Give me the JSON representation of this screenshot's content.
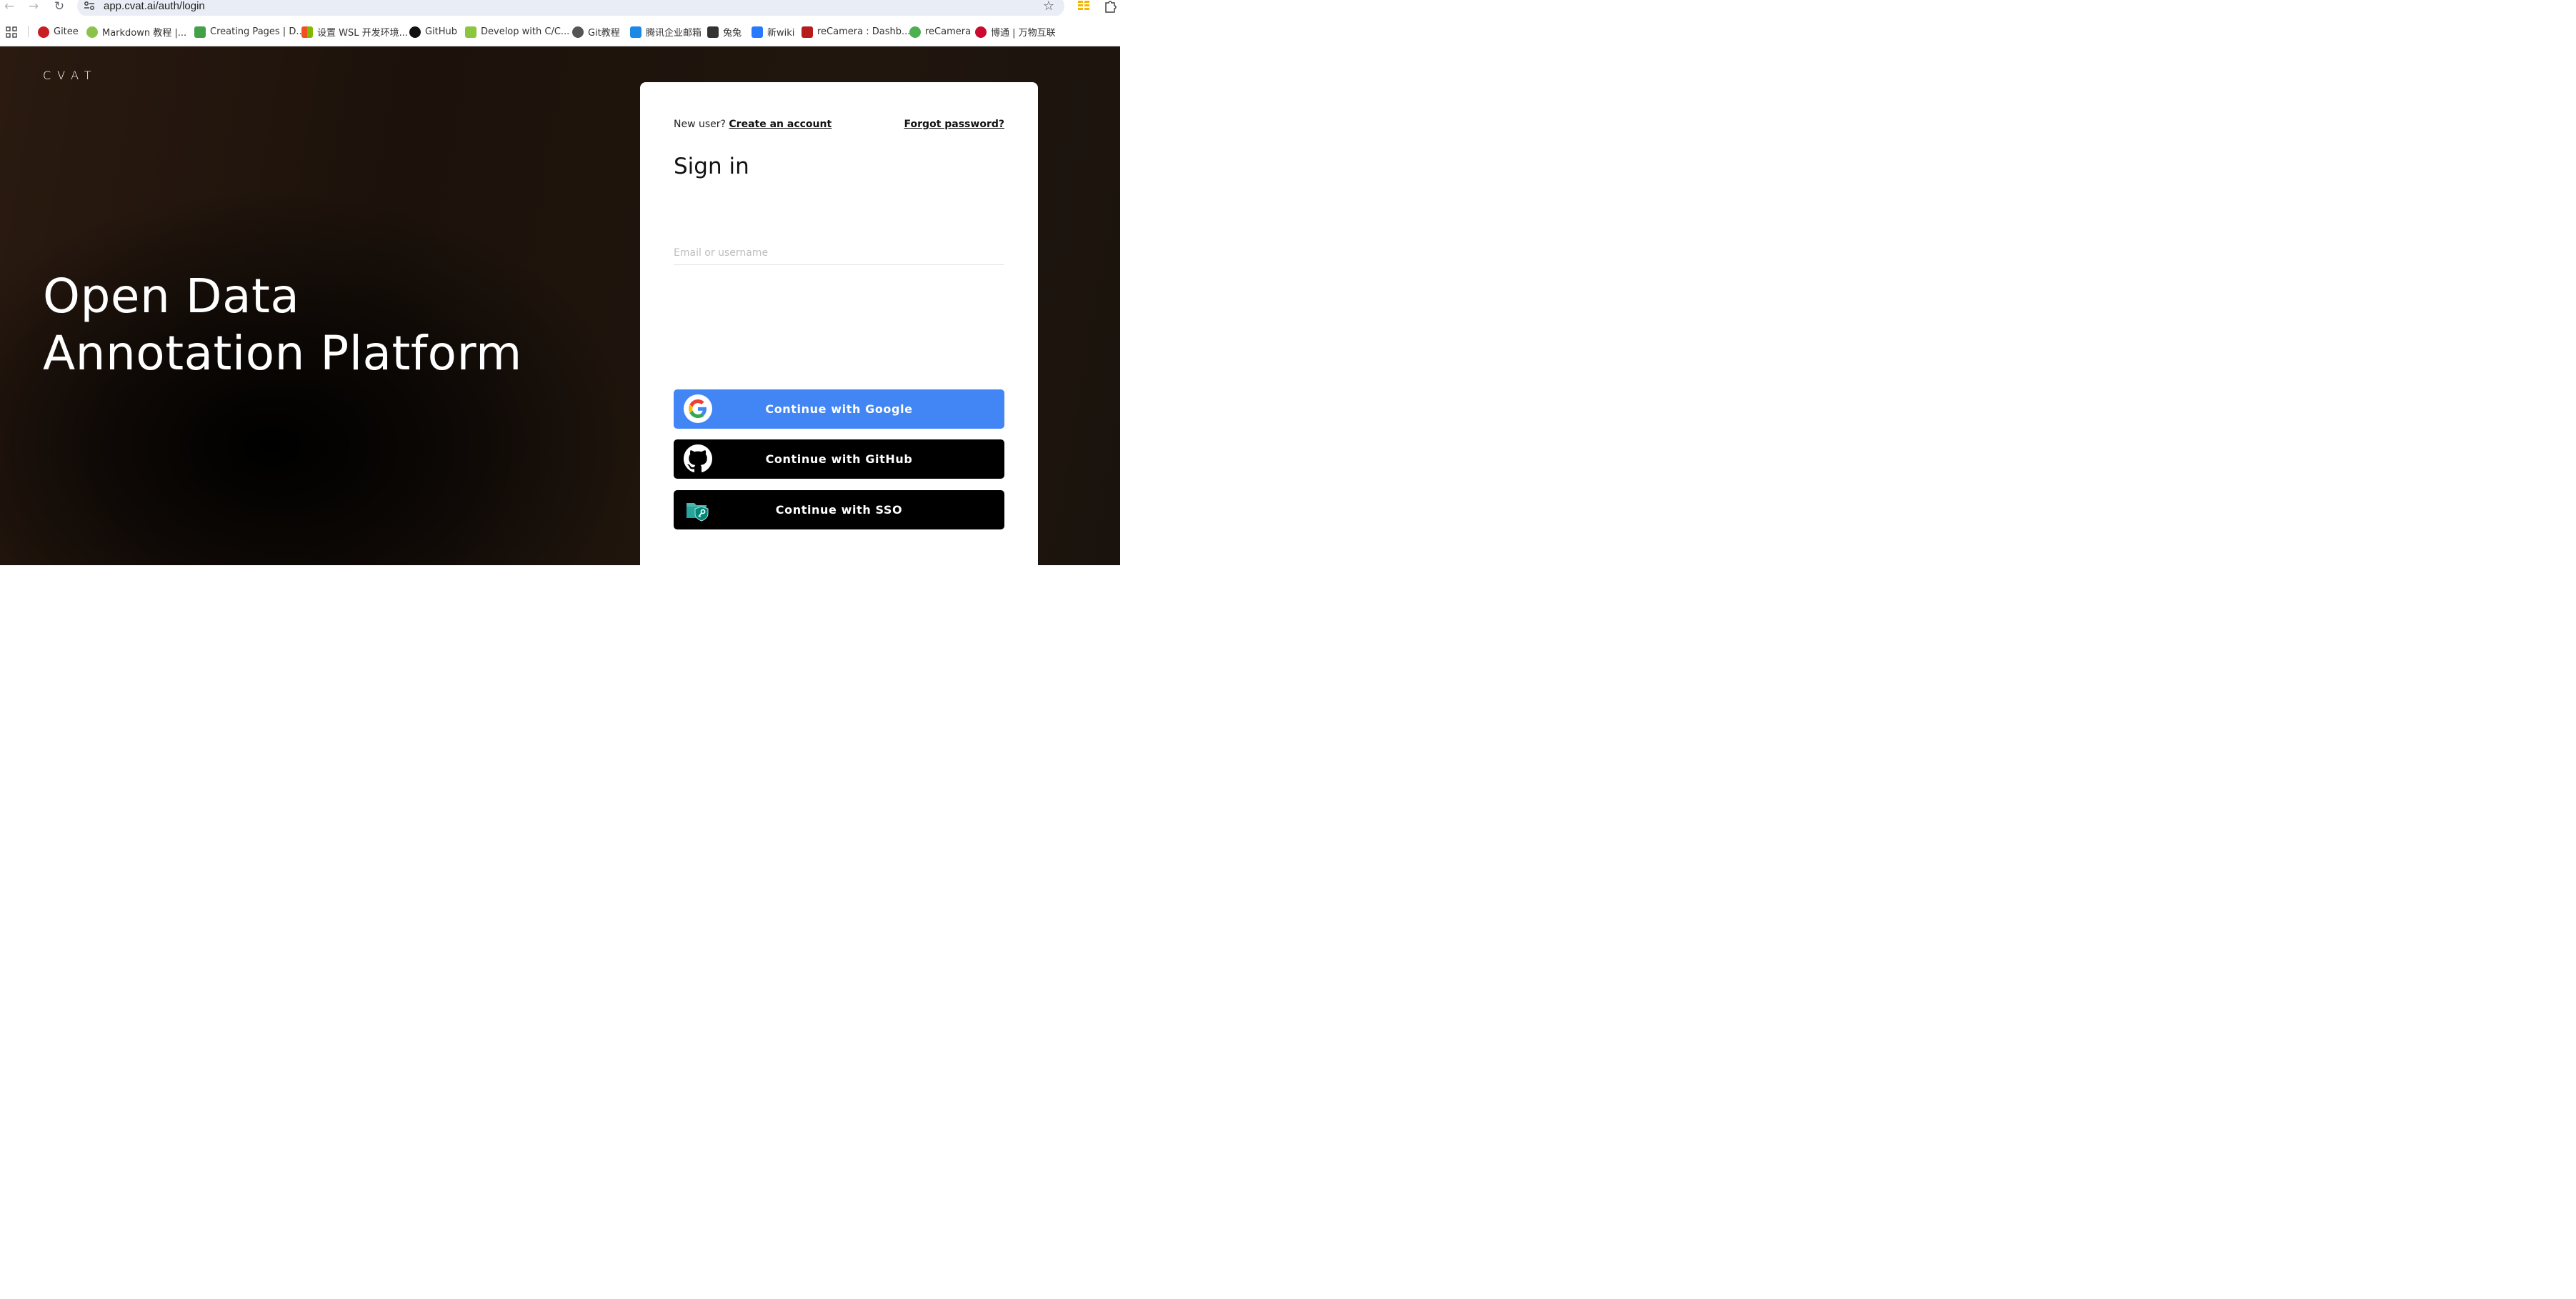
{
  "browser": {
    "url": "app.cvat.ai/auth/login",
    "bookmarks": [
      {
        "label": "Gitee",
        "icon": "gitee-icon",
        "color": "#c71d23"
      },
      {
        "label": "Markdown 教程 |...",
        "icon": "markdown-icon",
        "color": "#8bc34a"
      },
      {
        "label": "Creating Pages | D...",
        "icon": "pages-icon",
        "color": "#43a047"
      },
      {
        "label": "设置 WSL 开发环境...",
        "icon": "microsoft-icon",
        "color": "#f25022"
      },
      {
        "label": "GitHub",
        "icon": "github-icon",
        "color": "#111111"
      },
      {
        "label": "Develop with C/C...",
        "icon": "seeed-icon",
        "color": "#8cc63f"
      },
      {
        "label": "Git教程",
        "icon": "git-icon",
        "color": "#555555"
      },
      {
        "label": "腾讯企业邮箱",
        "icon": "tencent-mail-icon",
        "color": "#1e88e5"
      },
      {
        "label": "兔兔",
        "icon": "keyboard-icon",
        "color": "#333333"
      },
      {
        "label": "新wiki",
        "icon": "doc-icon",
        "color": "#2979ff"
      },
      {
        "label": "reCamera : Dashb...",
        "icon": "recamera-dashboard-icon",
        "color": "#b71c1c"
      },
      {
        "label": "reCamera",
        "icon": "recamera-icon",
        "color": "#4caf50"
      },
      {
        "label": "博通 | 万物互联",
        "icon": "broadcom-icon",
        "color": "#cc092f"
      }
    ]
  },
  "hero": {
    "logo": "CVAT",
    "headline_line1": "Open Data",
    "headline_line2": "Annotation Platform"
  },
  "signin": {
    "new_user_text": "New user?",
    "create_account_link": "Create an account",
    "forgot_password_link": "Forgot password?",
    "title": "Sign in",
    "email_placeholder": "Email or username",
    "google_button": "Continue with Google",
    "github_button": "Continue with GitHub",
    "sso_button": "Continue with SSO"
  },
  "colors": {
    "google_blue": "#4285f4",
    "button_dark": "#000000",
    "hero_bg": "#1c120b"
  }
}
